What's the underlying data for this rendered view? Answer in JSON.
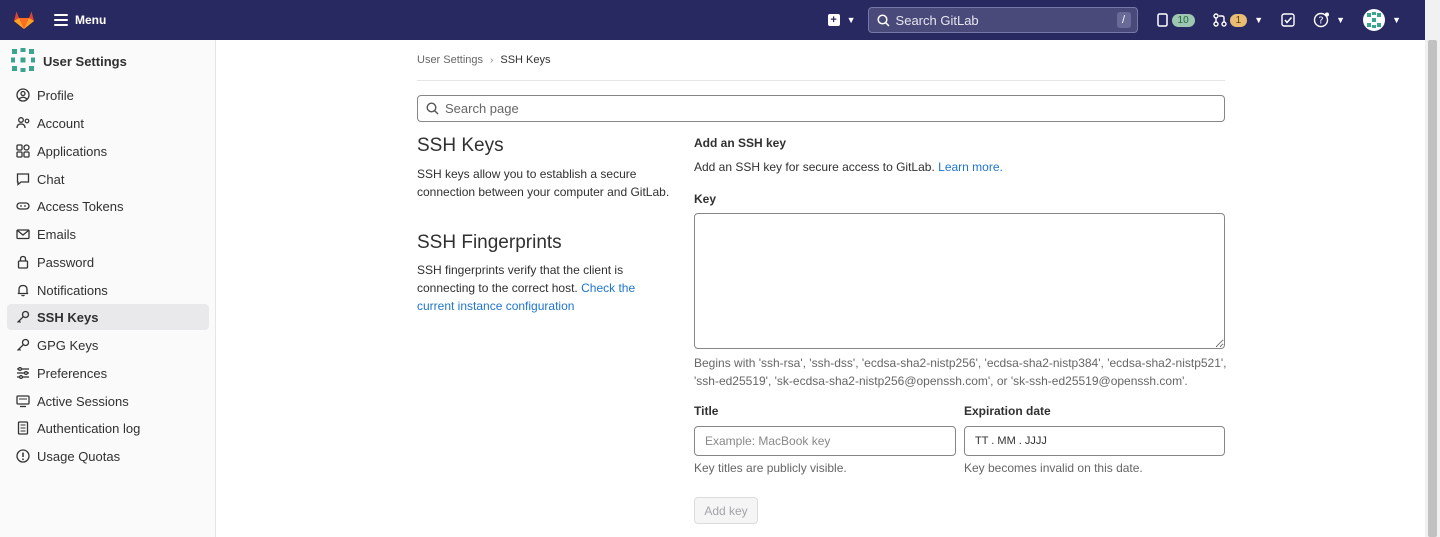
{
  "topbar": {
    "menu_label": "Menu",
    "search_placeholder": "Search GitLab",
    "search_shortcut": "/",
    "issues_count": "10",
    "merge_requests_count": "1",
    "brand_color": "#292961"
  },
  "sidebar": {
    "title": "User Settings",
    "items": [
      {
        "label": "Profile",
        "icon": "profile-icon"
      },
      {
        "label": "Account",
        "icon": "account-icon"
      },
      {
        "label": "Applications",
        "icon": "applications-icon"
      },
      {
        "label": "Chat",
        "icon": "chat-icon"
      },
      {
        "label": "Access Tokens",
        "icon": "token-icon"
      },
      {
        "label": "Emails",
        "icon": "mail-icon"
      },
      {
        "label": "Password",
        "icon": "lock-icon"
      },
      {
        "label": "Notifications",
        "icon": "bell-icon"
      },
      {
        "label": "SSH Keys",
        "icon": "key-icon",
        "active": true
      },
      {
        "label": "GPG Keys",
        "icon": "key-icon"
      },
      {
        "label": "Preferences",
        "icon": "preferences-icon"
      },
      {
        "label": "Active Sessions",
        "icon": "monitor-icon"
      },
      {
        "label": "Authentication log",
        "icon": "log-icon"
      },
      {
        "label": "Usage Quotas",
        "icon": "quota-icon"
      }
    ]
  },
  "breadcrumb": {
    "parent": "User Settings",
    "current": "SSH Keys"
  },
  "page_search": {
    "placeholder": "Search page"
  },
  "ssh_keys_section": {
    "title": "SSH Keys",
    "description": "SSH keys allow you to establish a secure connection between your computer and GitLab."
  },
  "fingerprints_section": {
    "title": "SSH Fingerprints",
    "description_line1": "SSH fingerprints verify that the client is",
    "description_line2": "connecting to the correct host.",
    "link_part1": "Check the",
    "link_part2": "current instance configuration"
  },
  "form": {
    "heading": "Add an SSH key",
    "intro": "Add an SSH key for secure access to GitLab.",
    "learn_more": "Learn more.",
    "key_label": "Key",
    "key_hint_line1": "Begins with 'ssh-rsa', 'ssh-dss', 'ecdsa-sha2-nistp256', 'ecdsa-sha2-nistp384', 'ecdsa-sha2-nistp521',",
    "key_hint_line2": "'ssh-ed25519', 'sk-ecdsa-sha2-nistp256@openssh.com', or 'sk-ssh-ed25519@openssh.com'.",
    "title_label": "Title",
    "title_placeholder": "Example: MacBook key",
    "title_hint": "Key titles are publicly visible.",
    "expiration_label": "Expiration date",
    "expiration_value": "TT . MM . JJJJ",
    "expiration_hint": "Key becomes invalid on this date.",
    "submit_label": "Add key"
  }
}
